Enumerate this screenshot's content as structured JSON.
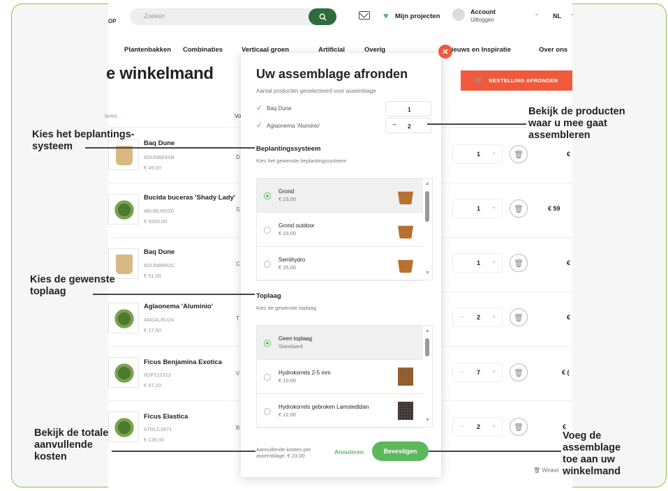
{
  "header": {
    "logo_fragment": "OP",
    "search_placeholder": "Zoeken",
    "projects_label": "Mijn projecten",
    "account_title": "Account",
    "account_sub": "Uitloggen",
    "language": "NL"
  },
  "nav": [
    "Plantenbakken",
    "Combinaties",
    "Verticaal groen",
    "Artificial",
    "Overig",
    "Nieuws en Inspiratie",
    "Over ons"
  ],
  "page": {
    "title_fragment": "e winkelmand",
    "order_button": "BESTELLING AFRONDEN",
    "col_header_left": "leren",
    "col_header_mid": "Vo",
    "footer_note": "Winkel"
  },
  "cart_items": [
    {
      "name": "Baq Dune",
      "sku": "6DUNBE60B",
      "price": "€ 49,00",
      "letter": "D",
      "qty": "1",
      "total": "€"
    },
    {
      "name": "Bucida buceras 'Shady Lady'",
      "sku": "4BUBUR020",
      "price": "€ 5950,00",
      "letter": "S",
      "qty": "1",
      "total": "€ 59"
    },
    {
      "name": "Baq Dune",
      "sku": "6DUNBR62C",
      "price": "€ 51,00",
      "letter": "C",
      "qty": "1",
      "total": "€"
    },
    {
      "name": "Aglaonema 'Aluminio'",
      "sku": "4AGALBU24",
      "price": "€ 17,50",
      "letter": "T",
      "qty": "2",
      "total": "€"
    },
    {
      "name": "Ficus Benjamina Exotica",
      "sku": "6DP112312",
      "price": "€ 67,20",
      "letter": "V",
      "qty": "7",
      "total": "€ ("
    },
    {
      "name": "Ficus Elastica",
      "sku": "6TRLC3971",
      "price": "€ 136,00",
      "letter": "B",
      "qty": "2",
      "total": "€"
    }
  ],
  "modal": {
    "title": "Uw assemblage afronden",
    "subtitle": "Aantal producten geselecteerd voor assemblage",
    "selected": [
      {
        "name": "Baq Dune",
        "qty": "1"
      },
      {
        "name": "Aglaonema 'Aluminio'",
        "qty": "2"
      }
    ],
    "planting": {
      "heading": "Beplantingssysteem",
      "sub": "Kies het gewenste beplantingssysteem",
      "options": [
        {
          "name": "Grond",
          "price": "€ 23,00",
          "selected": true
        },
        {
          "name": "Grond outdoor",
          "price": "€ 23,00",
          "selected": false
        },
        {
          "name": "Semihydro",
          "price": "€ 25,00",
          "selected": false
        }
      ]
    },
    "toplayer": {
      "heading": "Toplaag",
      "sub": "Kies de gewenste toplaag",
      "options": [
        {
          "name": "Geen toplaag",
          "price": "Standaard",
          "selected": true
        },
        {
          "name": "Hydrokorrels 2-5 mm",
          "price": "€ 10,00",
          "selected": false
        },
        {
          "name": "Hydrokorrels gebroken Lamstedtdan",
          "price": "€ 12,00",
          "selected": false
        }
      ]
    },
    "cost_line1": "Aanvullende kosten per",
    "cost_line2": "assemblage: € 23,00",
    "cancel": "Annuleren",
    "confirm": "Bevestigen"
  },
  "annotations": {
    "products": [
      "Bekijk de producten",
      "waar u mee gaat",
      "assembleren"
    ],
    "planting": [
      "Kies het beplantings-",
      "systeem"
    ],
    "toplayer": [
      "Kies de gewenste",
      "toplaag"
    ],
    "costs": [
      "Bekijk de totale",
      "aanvullende",
      "kosten"
    ],
    "add": [
      "Voeg de",
      "assemblage",
      "toe aan uw",
      "winkelmand"
    ]
  },
  "colors": {
    "accent_green": "#5cb85c",
    "dark_green": "#2f6b3c",
    "order_red": "#f05a3c",
    "frame": "#8cc63f"
  }
}
